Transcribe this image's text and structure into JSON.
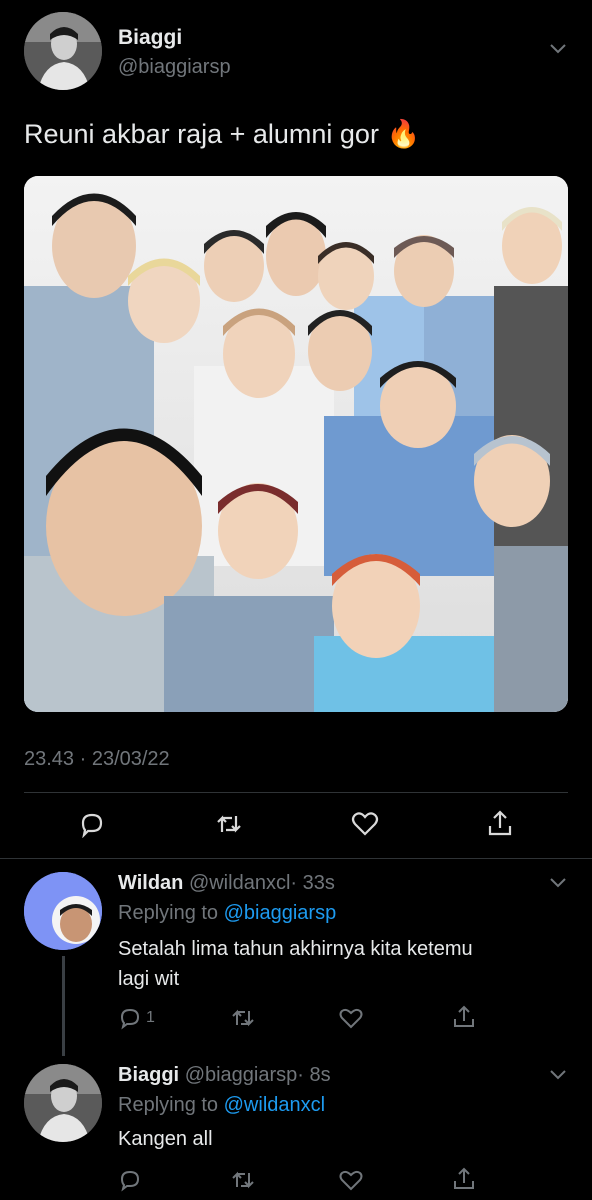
{
  "main_tweet": {
    "display_name": "Biaggi",
    "handle": "@biaggiarsp",
    "text": "Reuni akbar raja + alumni gor",
    "emoji": "🔥",
    "timestamp": "23.43 · 23/03/22",
    "actions": [
      "reply-icon",
      "retweet-icon",
      "like-icon",
      "share-icon"
    ]
  },
  "replies": [
    {
      "display_name": "Wildan",
      "handle": "@wildanxcl",
      "time": "· 33s",
      "replying_prefix": "Replying to",
      "replying_to": "@biaggiarsp",
      "text_line1": "Setalah lima tahun akhirnya kita ketemu",
      "text_line2": "lagi wit",
      "reply_count": "1",
      "avatar_bg": "#7e93f5"
    },
    {
      "display_name": "Biaggi",
      "handle": "@biaggiarsp",
      "time": "· 8s",
      "replying_prefix": "Replying to",
      "replying_to": "@wildanxcl",
      "text": "Kangen all"
    }
  ],
  "colors": {
    "background": "#000000",
    "text": "#e7e9ea",
    "muted": "#71767b",
    "link": "#1d9bf0",
    "divider": "#2f3336"
  }
}
